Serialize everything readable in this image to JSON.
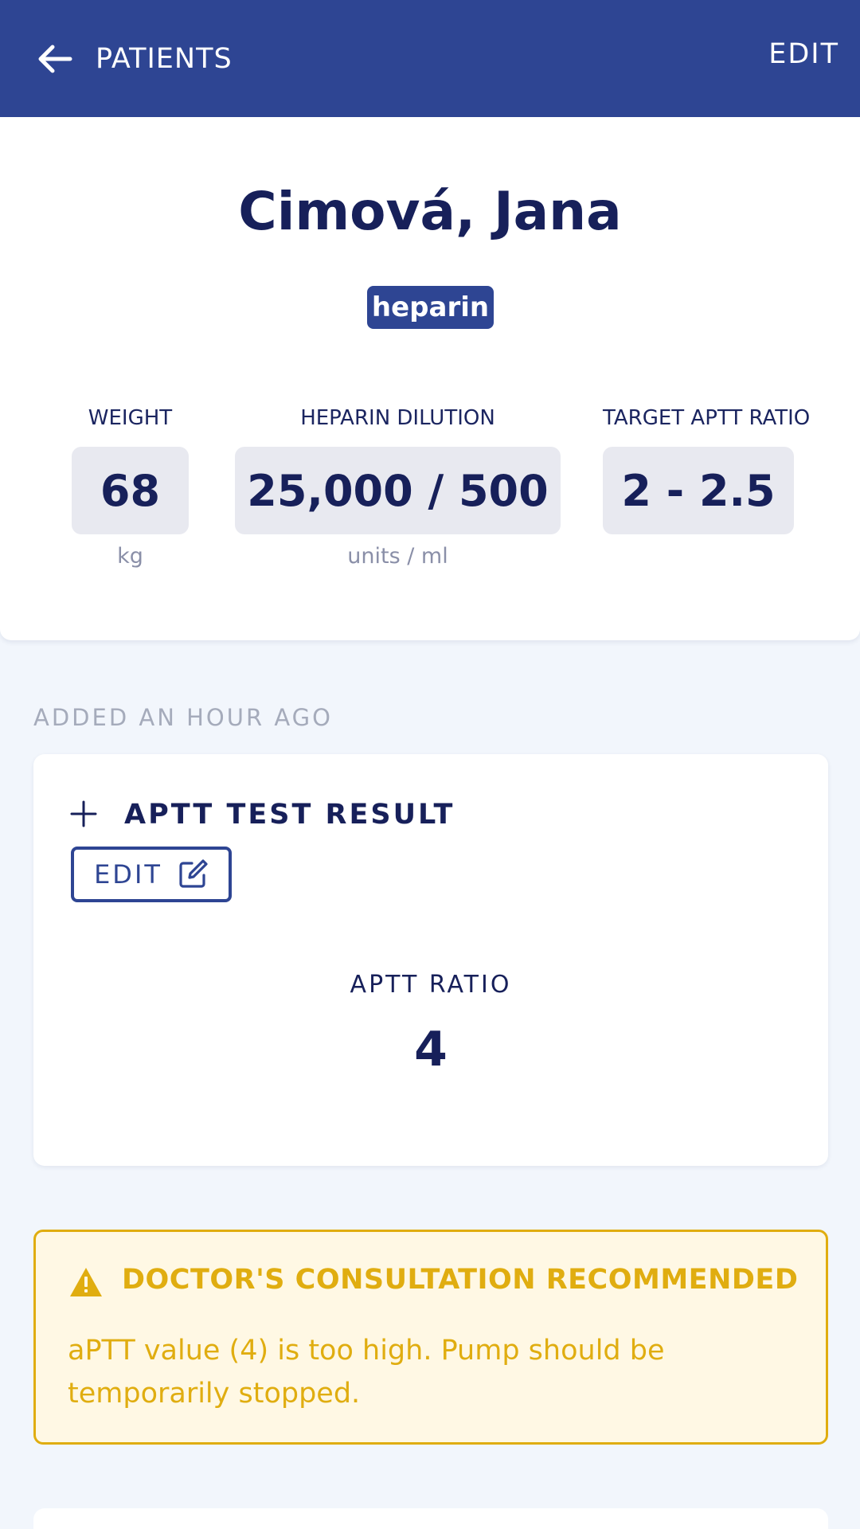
{
  "appbar": {
    "back_label": "PATIENTS",
    "edit_label": "EDIT"
  },
  "patient": {
    "name": "Cimová, Jana",
    "badge": "heparin",
    "weight": {
      "label": "WEIGHT",
      "value": "68",
      "unit": "kg"
    },
    "dilution": {
      "label": "HEPARIN DILUTION",
      "value": "25,000 / 500",
      "unit": "units / ml"
    },
    "target": {
      "label": "TARGET APTT RATIO",
      "value": "2 - 2.5"
    }
  },
  "entry": {
    "time": "ADDED AN HOUR AGO",
    "title": "APTT TEST RESULT",
    "edit_label": "EDIT",
    "ratio_label": "APTT RATIO",
    "ratio_value": "4"
  },
  "warning": {
    "title": "DOCTOR'S CONSULTATION RECOMMENDED",
    "text": "aPTT value (4) is too high. Pump should be temporarily stopped."
  },
  "colors": {
    "primary": "#2e4593",
    "warning": "#e0ad10",
    "warning_bg": "#fff8e4",
    "background": "#f2f6fc"
  },
  "icons": [
    "arrow-left-icon",
    "plus-icon",
    "edit-square-icon",
    "warning-triangle-icon"
  ]
}
